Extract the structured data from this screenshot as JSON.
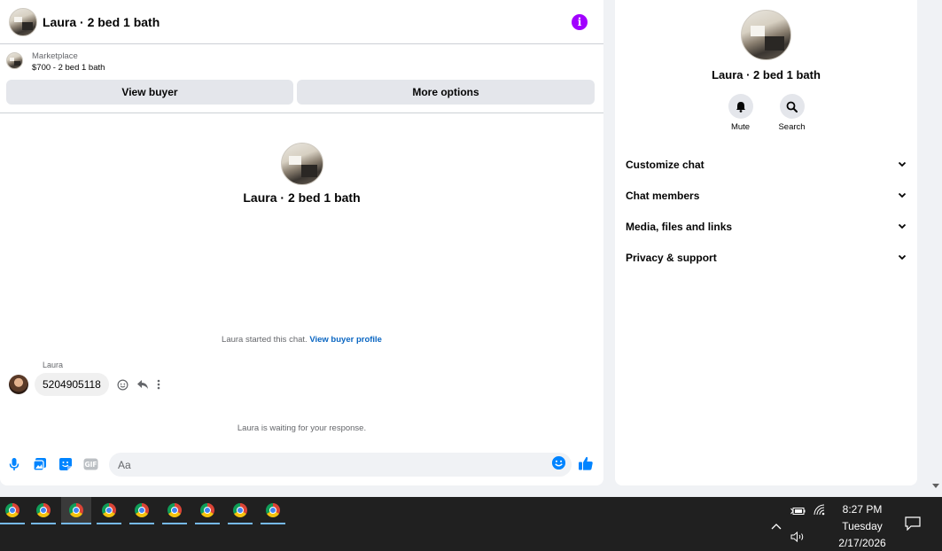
{
  "chat": {
    "header_title": "Laura · 2 bed 1 bath",
    "listing": {
      "category": "Marketplace",
      "item": "$700 - 2 bed 1 bath",
      "view_buyer": "View buyer",
      "more_options": "More options"
    },
    "intro_name": "Laura · 2 bed 1 bath",
    "started_text": "Laura started this chat. ",
    "started_link": "View buyer profile",
    "sender_name": "Laura",
    "message": "5204905118",
    "waiting_text": "Laura is waiting for your response.",
    "composer_placeholder": "Aa"
  },
  "details": {
    "name": "Laura · 2 bed 1 bath",
    "actions": [
      {
        "label": "Mute",
        "icon": "bell-icon"
      },
      {
        "label": "Search",
        "icon": "search-icon"
      }
    ],
    "sections": [
      {
        "title": "Customize chat"
      },
      {
        "title": "Chat members"
      },
      {
        "title": "Media, files and links"
      },
      {
        "title": "Privacy & support"
      }
    ]
  },
  "taskbar": {
    "apps": [
      "chrome-icon",
      "chrome-icon",
      "chrome-icon",
      "chrome-icon",
      "chrome-icon",
      "chrome-icon",
      "chrome-icon",
      "chrome-icon",
      "chrome-icon"
    ],
    "active_index": 2,
    "time": "8:27 PM",
    "day": "Tuesday",
    "date": "2/17/2026"
  },
  "colors": {
    "accent": "#0084ff",
    "info": "#a100ff",
    "link": "#0a66c2"
  }
}
